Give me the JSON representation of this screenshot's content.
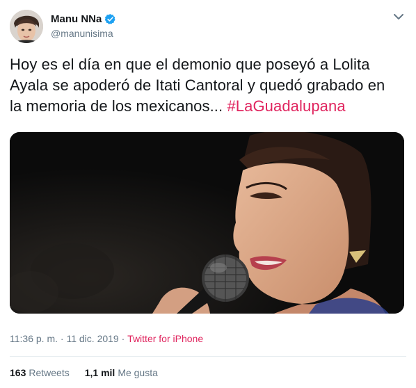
{
  "author": {
    "display_name": "Manu NNa",
    "handle": "@manunisima",
    "verified": true,
    "avatar_icon": "avatar-photo"
  },
  "tweet": {
    "text_line1": "Hoy es el día en que el demonio que poseyó a Lolita",
    "text_line2": "Ayala se apoderó de Itati Cantoral y quedó grabado en",
    "text_line3_plain": "la memoria de los mexicanos... ",
    "hashtag": "#LaGuadalupana"
  },
  "media": {
    "type": "video-still",
    "icon": "woman-singing-microphone-photo"
  },
  "meta": {
    "time": "11:36 p. m.",
    "separator": " · ",
    "date": "11 dic. 2019",
    "source": "Twitter for iPhone"
  },
  "stats": {
    "retweets_count": "163",
    "retweets_label": "Retweets",
    "likes_count": "1,1 mil",
    "likes_label": "Me gusta"
  },
  "colors": {
    "hashtag": "#e0245e",
    "verified": "#1da1f2",
    "secondary_text": "#657786"
  }
}
